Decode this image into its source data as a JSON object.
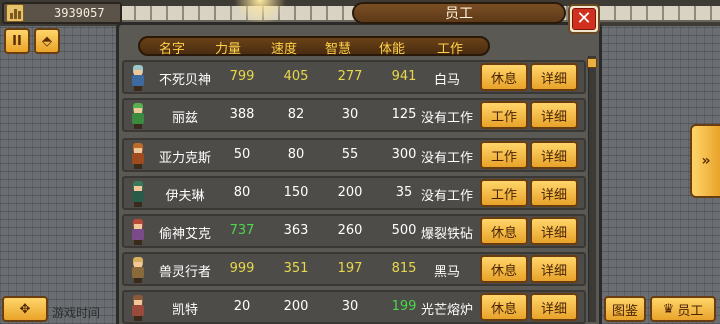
{
  "hud": {
    "money": "3939057",
    "money_icon": "building-icon",
    "pause_label": "II",
    "map_label": "⬘",
    "hint_text": "游戏时间",
    "right_panel_arrow": "»"
  },
  "dialog": {
    "title": "员工",
    "close_label": "✕",
    "columns": [
      "名字",
      "力量",
      "速度",
      "智慧",
      "体能",
      "工作"
    ],
    "rows": [
      {
        "name": "不死贝神",
        "power": "799",
        "speed": "405",
        "wisdom": "277",
        "stamina": "941",
        "job": "白马",
        "action": "休息",
        "detail": "详细",
        "colors": {
          "power": "#e8d84a",
          "speed": "#e8d84a",
          "wisdom": "#e8d84a",
          "stamina": "#e8d84a"
        },
        "avatar": {
          "hair": "#9cc8c8",
          "body": "#3d6aa0"
        }
      },
      {
        "name": "丽兹",
        "power": "388",
        "speed": "82",
        "wisdom": "30",
        "stamina": "125",
        "job": "没有工作",
        "action": "工作",
        "detail": "详细",
        "colors": {
          "power": "#ffffff",
          "speed": "#ffffff",
          "wisdom": "#ffffff",
          "stamina": "#ffffff"
        },
        "avatar": {
          "hair": "#58b050",
          "body": "#3a8a40"
        }
      },
      {
        "name": "亚力克斯",
        "power": "50",
        "speed": "80",
        "wisdom": "55",
        "stamina": "300",
        "job": "没有工作",
        "action": "工作",
        "detail": "详细",
        "colors": {
          "power": "#ffffff",
          "speed": "#ffffff",
          "wisdom": "#ffffff",
          "stamina": "#ffffff"
        },
        "avatar": {
          "hair": "#c06a2a",
          "body": "#a04a20"
        }
      },
      {
        "name": "伊夫琳",
        "power": "80",
        "speed": "150",
        "wisdom": "200",
        "stamina": "35",
        "job": "没有工作",
        "action": "工作",
        "detail": "详细",
        "colors": {
          "power": "#ffffff",
          "speed": "#ffffff",
          "wisdom": "#ffffff",
          "stamina": "#ffffff"
        },
        "avatar": {
          "hair": "#3a7a5a",
          "body": "#2a5a4a"
        }
      },
      {
        "name": "偷神艾克",
        "power": "737",
        "speed": "363",
        "wisdom": "260",
        "stamina": "500",
        "job": "爆裂铁砧",
        "action": "休息",
        "detail": "详细",
        "colors": {
          "power": "#4cd84c",
          "speed": "#ffffff",
          "wisdom": "#ffffff",
          "stamina": "#ffffff"
        },
        "avatar": {
          "hair": "#b84a3a",
          "body": "#7a4a8a"
        }
      },
      {
        "name": "兽灵行者",
        "power": "999",
        "speed": "351",
        "wisdom": "197",
        "stamina": "815",
        "job": "黑马",
        "action": "休息",
        "detail": "详细",
        "colors": {
          "power": "#e8d84a",
          "speed": "#e8d84a",
          "wisdom": "#e8d84a",
          "stamina": "#e8d84a"
        },
        "avatar": {
          "hair": "#d8b060",
          "body": "#8a6a3a"
        }
      },
      {
        "name": "凯特",
        "power": "20",
        "speed": "200",
        "wisdom": "30",
        "stamina": "199",
        "job": "光芒熔炉",
        "action": "休息",
        "detail": "详细",
        "colors": {
          "power": "#ffffff",
          "speed": "#ffffff",
          "wisdom": "#ffffff",
          "stamina": "#4cd84c"
        },
        "avatar": {
          "hair": "#8a5a3a",
          "body": "#9a4a3a"
        }
      }
    ]
  },
  "bottom": {
    "move_label": "✥",
    "gallery_label": "图鉴",
    "staff_label": "员工",
    "staff_icon": "crown-icon"
  }
}
